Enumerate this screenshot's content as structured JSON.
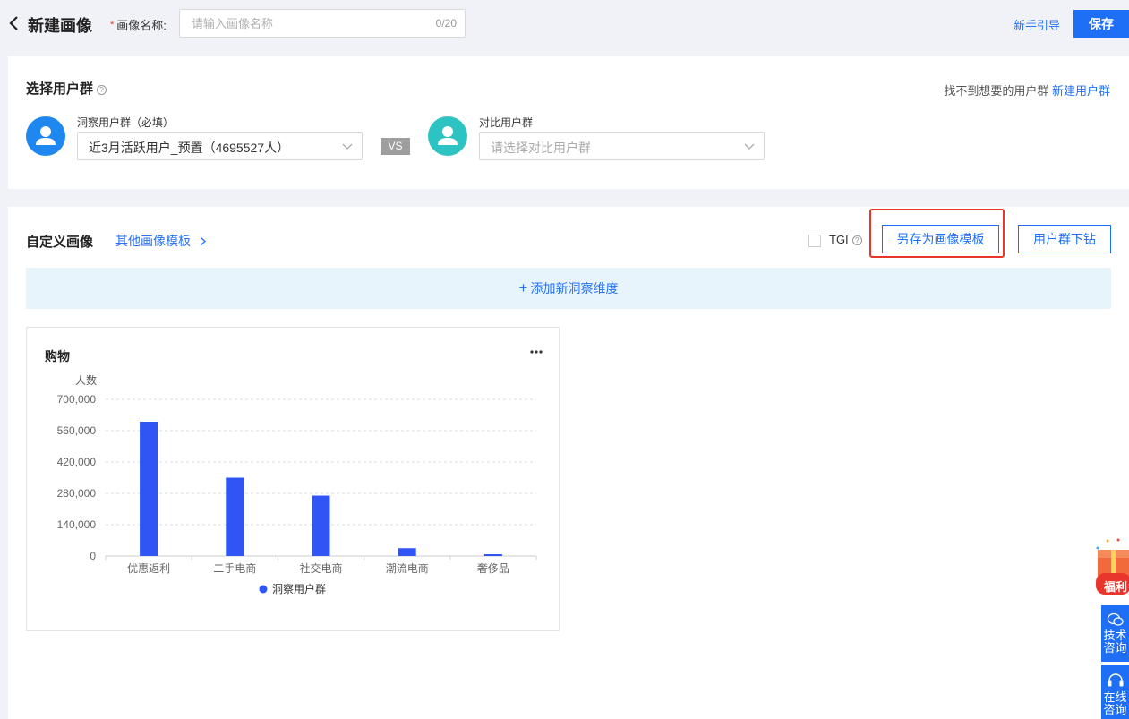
{
  "header": {
    "title": "新建画像",
    "name_label": "画像名称:",
    "name_placeholder": "请输入画像名称",
    "name_value": "",
    "name_count": "0/20",
    "guide_label": "新手引导",
    "save_label": "保存"
  },
  "user_groups": {
    "title": "选择用户群",
    "not_found_text": "找不到想要的用户群",
    "create_link": "新建用户群",
    "insight": {
      "label": "洞察用户群（必填）",
      "value": "近3月活跃用户_预置（4695527人）",
      "avatar_color": "#1e88f0"
    },
    "vs_label": "VS",
    "compare": {
      "label": "对比用户群",
      "placeholder": "请选择对比用户群",
      "avatar_color": "#2ec3c3"
    }
  },
  "portrait": {
    "title": "自定义画像",
    "templates_link": "其他画像模板",
    "tgi_label": "TGI",
    "tgi_checked": false,
    "save_template_label": "另存为画像模板",
    "drilldown_label": "用户群下钻",
    "add_dimension_label": "添加新洞察维度",
    "highlight_color": "#e8362c"
  },
  "chart_data": {
    "type": "bar",
    "title": "购物",
    "ylabel": "人数",
    "categories": [
      "优惠返利",
      "二手电商",
      "社交电商",
      "潮流电商",
      "奢侈品"
    ],
    "series": [
      {
        "name": "洞察用户群",
        "color": "#3055f5",
        "values": [
          600000,
          350000,
          270000,
          35000,
          8000
        ]
      }
    ],
    "yticks": [
      "0",
      "140,000",
      "280,000",
      "420,000",
      "560,000",
      "700,000"
    ],
    "ylim": [
      0,
      700000
    ],
    "grid": true,
    "legend_position": "bottom"
  },
  "floating": {
    "gift_label": "福利",
    "tech_label_1": "技术",
    "tech_label_2": "咨询",
    "online_label_1": "在线",
    "online_label_2": "咨询"
  }
}
